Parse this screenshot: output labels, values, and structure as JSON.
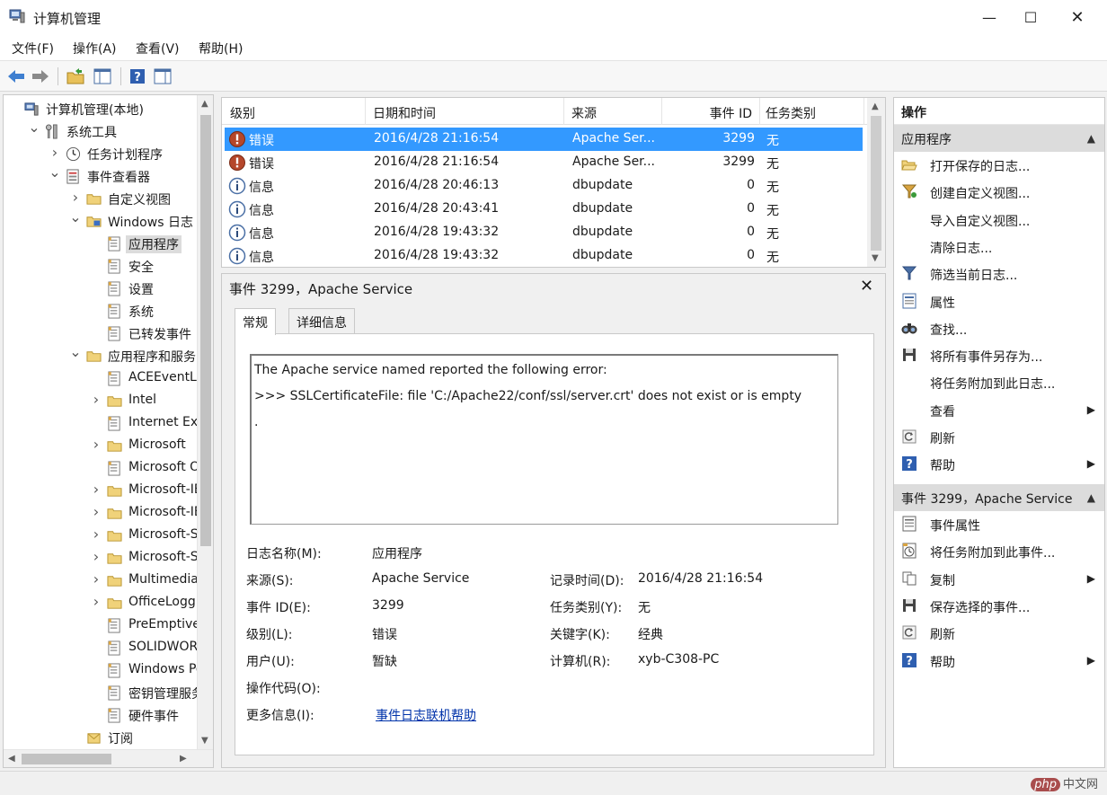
{
  "window": {
    "title": "计算机管理",
    "minimize_glyph": "—",
    "maximize_glyph": "☐",
    "close_glyph": "✕"
  },
  "menu": [
    "文件(F)",
    "操作(A)",
    "查看(V)",
    "帮助(H)"
  ],
  "toolbar": {
    "buttons": [
      "back-arrow-icon",
      "forward-arrow-icon",
      "up-folder-icon",
      "show-hide-tree-icon",
      "help-icon",
      "properties-icon"
    ]
  },
  "tree": [
    {
      "label": "计算机管理(本地)",
      "icon": "computer-management-icon",
      "depth": 0,
      "arrow": ""
    },
    {
      "label": "系统工具",
      "icon": "system-tools-icon",
      "depth": 1,
      "arrow": "v"
    },
    {
      "label": "任务计划程序",
      "icon": "clock-icon",
      "depth": 2,
      "arrow": ">"
    },
    {
      "label": "事件查看器",
      "icon": "event-viewer-icon",
      "depth": 2,
      "arrow": "v"
    },
    {
      "label": "自定义视图",
      "icon": "folder-icon",
      "depth": 3,
      "arrow": ">"
    },
    {
      "label": "Windows 日志",
      "icon": "windows-log-icon",
      "depth": 3,
      "arrow": "v"
    },
    {
      "label": "应用程序",
      "icon": "log-icon",
      "depth": 4,
      "arrow": "",
      "selected": true
    },
    {
      "label": "安全",
      "icon": "log-icon",
      "depth": 4,
      "arrow": ""
    },
    {
      "label": "设置",
      "icon": "log-icon",
      "depth": 4,
      "arrow": ""
    },
    {
      "label": "系统",
      "icon": "log-icon",
      "depth": 4,
      "arrow": ""
    },
    {
      "label": "已转发事件",
      "icon": "log-icon",
      "depth": 4,
      "arrow": ""
    },
    {
      "label": "应用程序和服务日",
      "icon": "folder-icon",
      "depth": 3,
      "arrow": "v"
    },
    {
      "label": "ACEEventLo",
      "icon": "log-icon",
      "depth": 4,
      "arrow": ""
    },
    {
      "label": "Intel",
      "icon": "folder-icon",
      "depth": 4,
      "arrow": ">"
    },
    {
      "label": "Internet Exp",
      "icon": "log-icon",
      "depth": 4,
      "arrow": ""
    },
    {
      "label": "Microsoft",
      "icon": "folder-icon",
      "depth": 4,
      "arrow": ">"
    },
    {
      "label": "Microsoft O",
      "icon": "log-icon",
      "depth": 4,
      "arrow": ""
    },
    {
      "label": "Microsoft-IE",
      "icon": "folder-icon",
      "depth": 4,
      "arrow": ">"
    },
    {
      "label": "Microsoft-IE",
      "icon": "folder-icon",
      "depth": 4,
      "arrow": ">"
    },
    {
      "label": "Microsoft-S",
      "icon": "folder-icon",
      "depth": 4,
      "arrow": ">"
    },
    {
      "label": "Microsoft-S",
      "icon": "folder-icon",
      "depth": 4,
      "arrow": ">"
    },
    {
      "label": "Multimedia-",
      "icon": "folder-icon",
      "depth": 4,
      "arrow": ">"
    },
    {
      "label": "OfficeLoggi",
      "icon": "folder-icon",
      "depth": 4,
      "arrow": ">"
    },
    {
      "label": "PreEmptive",
      "icon": "log-icon",
      "depth": 4,
      "arrow": ""
    },
    {
      "label": "SOLIDWORK",
      "icon": "log-icon",
      "depth": 4,
      "arrow": ""
    },
    {
      "label": "Windows Po",
      "icon": "log-icon",
      "depth": 4,
      "arrow": ""
    },
    {
      "label": "密钥管理服务",
      "icon": "log-icon",
      "depth": 4,
      "arrow": ""
    },
    {
      "label": "硬件事件",
      "icon": "log-icon",
      "depth": 4,
      "arrow": ""
    },
    {
      "label": "订阅",
      "icon": "subscription-icon",
      "depth": 3,
      "arrow": ""
    }
  ],
  "events": {
    "columns": [
      "级别",
      "日期和时间",
      "来源",
      "事件 ID",
      "任务类别"
    ],
    "rows": [
      {
        "level": "错误",
        "type": "error",
        "datetime": "2016/4/28 21:16:54",
        "source": "Apache Ser...",
        "id": "3299",
        "category": "无",
        "selected": true
      },
      {
        "level": "错误",
        "type": "error",
        "datetime": "2016/4/28 21:16:54",
        "source": "Apache Ser...",
        "id": "3299",
        "category": "无"
      },
      {
        "level": "信息",
        "type": "info",
        "datetime": "2016/4/28 20:46:13",
        "source": "dbupdate",
        "id": "0",
        "category": "无"
      },
      {
        "level": "信息",
        "type": "info",
        "datetime": "2016/4/28 20:43:41",
        "source": "dbupdate",
        "id": "0",
        "category": "无"
      },
      {
        "level": "信息",
        "type": "info",
        "datetime": "2016/4/28 19:43:32",
        "source": "dbupdate",
        "id": "0",
        "category": "无"
      },
      {
        "level": "信息",
        "type": "info",
        "datetime": "2016/4/28 19:43:32",
        "source": "dbupdate",
        "id": "0",
        "category": "无"
      }
    ]
  },
  "detail": {
    "title": "事件 3299，Apache Service",
    "close_glyph": "✕",
    "tabs": [
      "常规",
      "详细信息"
    ],
    "description": [
      "The Apache service named  reported the following error:",
      ">>> SSLCertificateFile: file 'C:/Apache22/conf/ssl/server.crt' does not exist or is empty",
      "."
    ],
    "props": {
      "log_name_label": "日志名称(M):",
      "log_name": "应用程序",
      "source_label": "来源(S):",
      "source": "Apache Service",
      "logged_label": "记录时间(D):",
      "logged": "2016/4/28 21:16:54",
      "event_id_label": "事件 ID(E):",
      "event_id": "3299",
      "task_category_label": "任务类别(Y):",
      "task_category": "无",
      "level_label": "级别(L):",
      "level": "错误",
      "keywords_label": "关键字(K):",
      "keywords": "经典",
      "user_label": "用户(U):",
      "user": "暂缺",
      "computer_label": "计算机(R):",
      "computer": "xyb-C308-PC",
      "opcode_label": "操作代码(O):",
      "more_info_label": "更多信息(I):",
      "more_info_link": "事件日志联机帮助"
    }
  },
  "actions": {
    "title": "操作",
    "section1": "应用程序",
    "section1_items": [
      {
        "label": "打开保存的日志...",
        "icon": "open-folder-icon"
      },
      {
        "label": "创建自定义视图...",
        "icon": "create-filter-icon"
      },
      {
        "label": "导入自定义视图...",
        "icon": ""
      },
      {
        "label": "清除日志...",
        "icon": ""
      },
      {
        "label": "筛选当前日志...",
        "icon": "filter-icon"
      },
      {
        "label": "属性",
        "icon": "properties-icon"
      },
      {
        "label": "查找...",
        "icon": "binoculars-icon"
      },
      {
        "label": "将所有事件另存为...",
        "icon": "save-icon"
      },
      {
        "label": "将任务附加到此日志...",
        "icon": ""
      },
      {
        "label": "查看",
        "icon": "",
        "sub": true
      },
      {
        "label": "刷新",
        "icon": "refresh-icon"
      },
      {
        "label": "帮助",
        "icon": "help-icon",
        "sub": true
      }
    ],
    "section2": "事件 3299，Apache Service",
    "section2_items": [
      {
        "label": "事件属性",
        "icon": "event-properties-icon"
      },
      {
        "label": "将任务附加到此事件...",
        "icon": "attach-task-icon"
      },
      {
        "label": "复制",
        "icon": "copy-icon",
        "sub": true
      },
      {
        "label": "保存选择的事件...",
        "icon": "save-icon"
      },
      {
        "label": "刷新",
        "icon": "refresh-icon"
      },
      {
        "label": "帮助",
        "icon": "help-icon",
        "sub": true
      }
    ],
    "caret_glyph": "▲",
    "submenu_glyph": "▶"
  },
  "status": {
    "watermark_badge": "php",
    "watermark_text": "中文网"
  },
  "colors": {
    "selection": "#3399ff",
    "error": "#b5472b",
    "info_ring": "#4a6fa5",
    "section_bg": "#dcdcdc",
    "link": "#0033aa"
  }
}
